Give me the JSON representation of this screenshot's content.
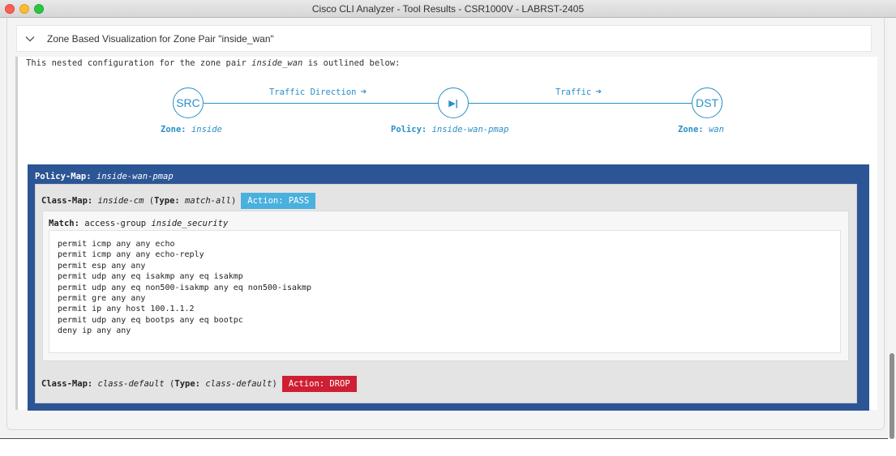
{
  "window": {
    "title": "Cisco CLI Analyzer - Tool Results - CSR1000V - LABRST-2405"
  },
  "accordion": {
    "title": "Zone Based Visualization for Zone Pair \"inside_wan\""
  },
  "intro": {
    "prefix": "This nested configuration for the zone pair ",
    "zone_pair": "inside_wan",
    "suffix": " is outlined below:"
  },
  "flow": {
    "src_node": "SRC",
    "policy_icon": "▶|",
    "dst_node": "DST",
    "link1_label": "Traffic Direction",
    "link2_label": "Traffic",
    "src_zone_key": "Zone:",
    "src_zone_value": "inside",
    "policy_key": "Policy:",
    "policy_value": "inside-wan-pmap",
    "dst_zone_key": "Zone:",
    "dst_zone_value": "wan"
  },
  "policy_map": {
    "key": "Policy-Map:",
    "name": "inside-wan-pmap",
    "class_maps": [
      {
        "key": "Class-Map:",
        "name": "inside-cm",
        "type_key": "Type:",
        "type": "match-all",
        "action": "Action: PASS",
        "match_key": "Match:",
        "match_text": "access-group",
        "match_name": "inside_security",
        "acl": [
          "permit icmp any any echo",
          "permit icmp any any echo-reply",
          "permit esp any any",
          "permit udp any eq isakmp any eq isakmp",
          "permit udp any eq non500-isakmp any eq non500-isakmp",
          "permit gre any any",
          "permit ip any host 100.1.1.2",
          "permit udp any eq bootps any eq bootpc",
          "deny ip any any"
        ]
      },
      {
        "key": "Class-Map:",
        "name": "class-default",
        "type_key": "Type:",
        "type": "class-default",
        "action": "Action: DROP"
      }
    ]
  },
  "colors": {
    "accent": "#2a8fc9",
    "policy_bg": "#2c5595",
    "pass": "#4ab0de",
    "drop": "#cf1f32"
  }
}
